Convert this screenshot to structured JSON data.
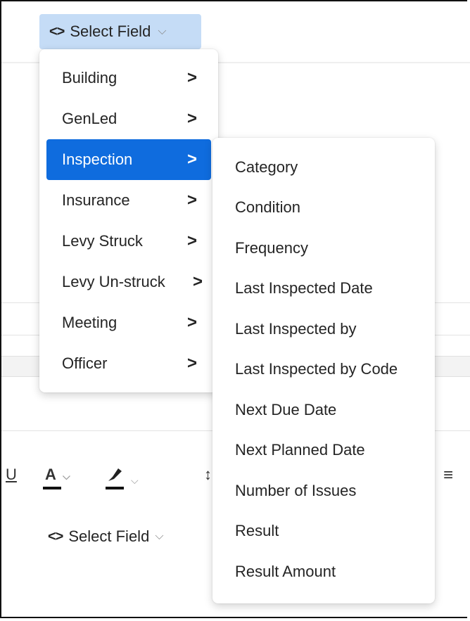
{
  "top_button": {
    "icon": "code-brackets-icon",
    "label": "Select Field",
    "chevron": "chevron-down-icon"
  },
  "main_menu": {
    "items": [
      {
        "label": "Building",
        "arrow": ">"
      },
      {
        "label": "GenLed",
        "arrow": ">"
      },
      {
        "label": "Inspection",
        "arrow": ">",
        "active": true
      },
      {
        "label": "Insurance",
        "arrow": ">"
      },
      {
        "label": "Levy Struck",
        "arrow": ">"
      },
      {
        "label": "Levy Un-struck",
        "arrow": ">"
      },
      {
        "label": "Meeting",
        "arrow": ">"
      },
      {
        "label": "Officer",
        "arrow": ">"
      }
    ]
  },
  "sub_menu": {
    "items": [
      "Category",
      "Condition",
      "Frequency",
      "Last Inspected Date",
      "Last Inspected by",
      "Last Inspected by Code",
      "Next Due Date",
      "Next Planned Date",
      "Number of Issues",
      "Result",
      "Result Amount"
    ]
  },
  "toolbar": {
    "underline": "U",
    "font_color": "A",
    "highlight_icon": "highlighter-icon",
    "partial_icon": "line-spacing-icon",
    "align_icon": "align-left-icon"
  },
  "second_button": {
    "label": "Select Field"
  },
  "colors": {
    "accent": "#0f6cde",
    "button_bg": "#c5dcf6"
  }
}
